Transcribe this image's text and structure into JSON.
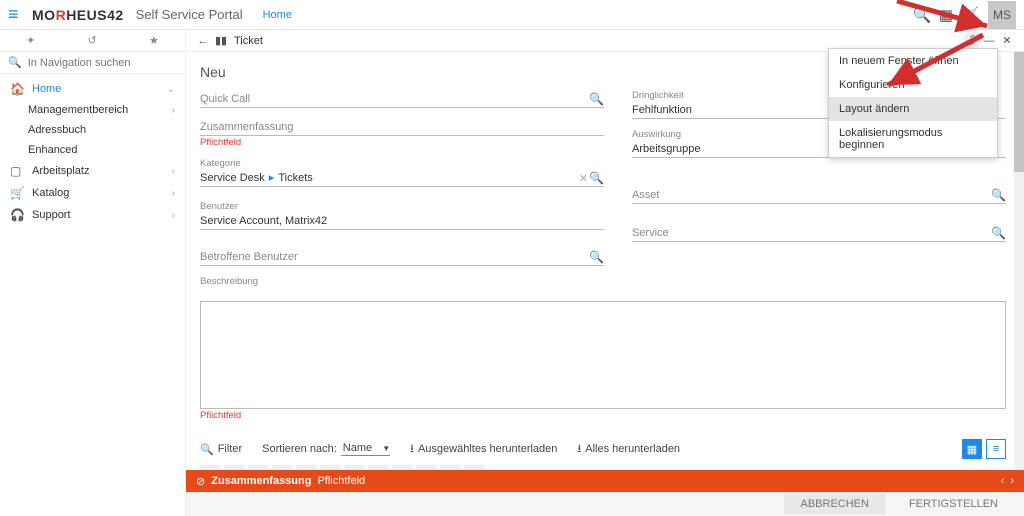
{
  "brand": {
    "pre": "MO",
    "r": "R",
    "post": "HEUS42"
  },
  "portal_title": "Self Service Portal",
  "breadcrumb": "Home",
  "avatar": "MS",
  "search_placeholder": "In Navigation suchen",
  "nav": {
    "home": "Home",
    "sub": [
      "Managementbereich",
      "Adressbuch",
      "Enhanced"
    ],
    "items": [
      {
        "icon": "▭",
        "label": "Arbeitsplatz"
      },
      {
        "icon": "🛒",
        "label": "Katalog"
      },
      {
        "icon": "🎧",
        "label": "Support"
      }
    ]
  },
  "panel": {
    "title": "Ticket",
    "heading": "Neu",
    "menu": [
      "In neuem Fenster öffnen",
      "Konfigurieren",
      "Layout ändern",
      "Lokalisierungsmodus beginnen"
    ],
    "menu_hover_index": 2
  },
  "fields": {
    "quickcall": "Quick Call",
    "zusammen": "Zusammenfassung",
    "required": "Pflichtfeld",
    "kategorie_lbl": "Kategorie",
    "kategorie_path": [
      "Service Desk",
      "Tickets"
    ],
    "benutzer_lbl": "Benutzer",
    "benutzer_val": "Service Account, Matrix42",
    "betroffene": "Betroffene Benutzer",
    "beschreibung": "Beschreibung",
    "dringlichkeit_lbl": "Dringlichkeit",
    "dringlichkeit_val": "Fehlfunktion",
    "auswirkung_lbl": "Auswirkung",
    "auswirkung_val": "Arbeitsgruppe",
    "asset": "Asset",
    "service": "Service"
  },
  "filterbar": {
    "filter": "Filter",
    "sort_label": "Sortieren nach:",
    "sort_value": "Name",
    "dl_sel": "Ausgewähltes herunterladen",
    "dl_all": "Alles herunterladen"
  },
  "error": {
    "field": "Zusammenfassung",
    "msg": "Pflichtfeld"
  },
  "footer": {
    "cancel": "ABBRECHEN",
    "finish": "FERTIGSTELLEN"
  }
}
